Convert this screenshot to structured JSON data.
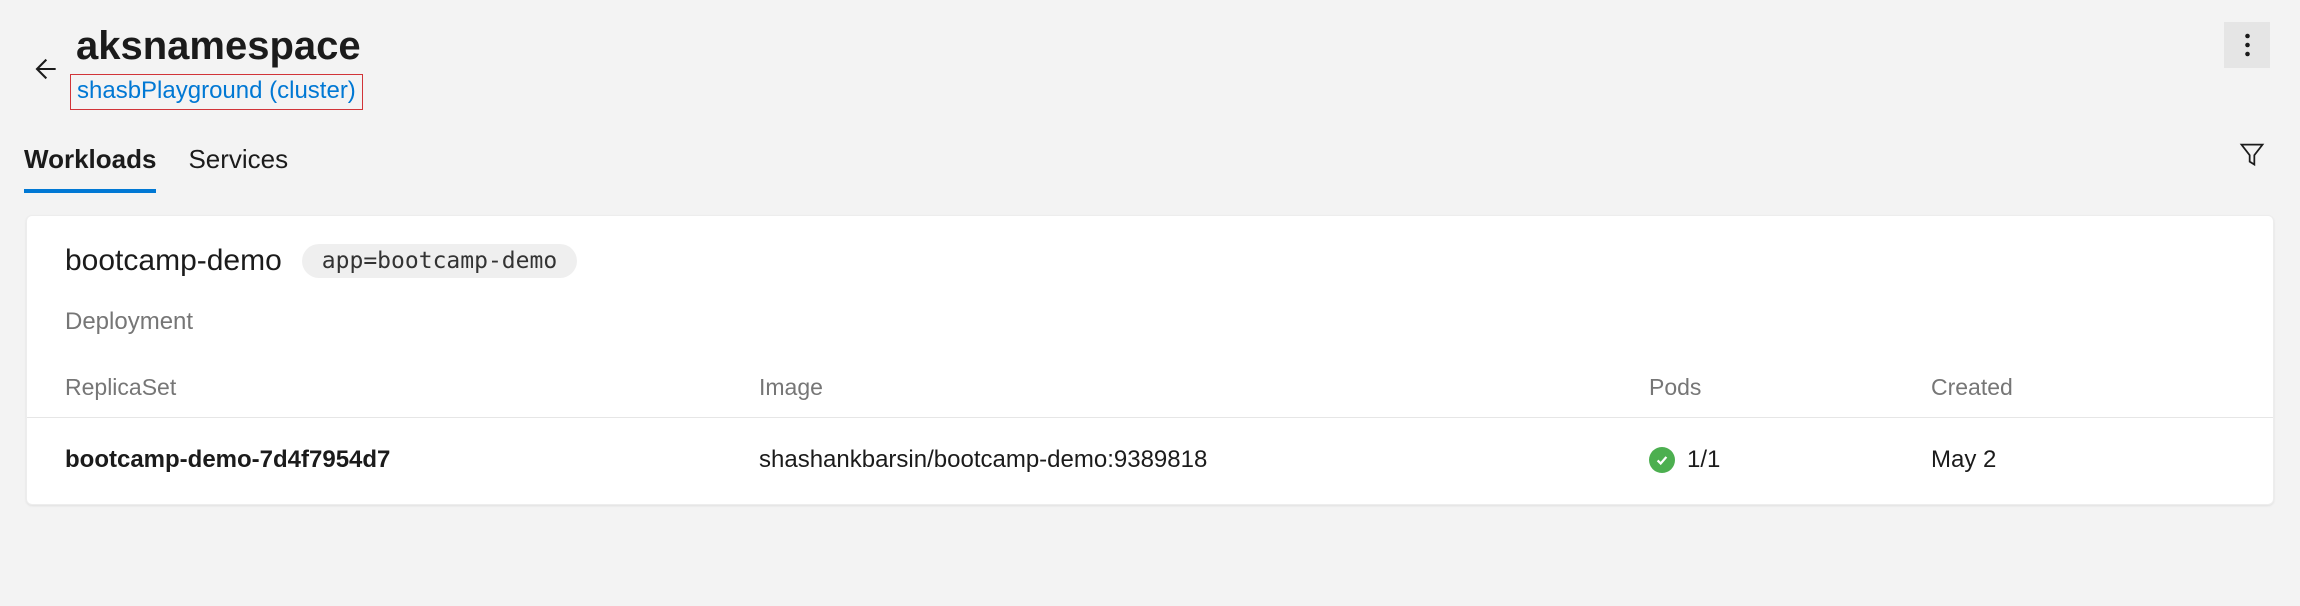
{
  "header": {
    "title": "aksnamespace",
    "cluster_link": "shasbPlayground (cluster)"
  },
  "tabs": [
    {
      "label": "Workloads",
      "active": true
    },
    {
      "label": "Services",
      "active": false
    }
  ],
  "workload": {
    "name": "bootcamp-demo",
    "tag": "app=bootcamp-demo",
    "type": "Deployment",
    "columns": {
      "replicaset": "ReplicaSet",
      "image": "Image",
      "pods": "Pods",
      "created": "Created"
    },
    "rows": [
      {
        "replicaset": "bootcamp-demo-7d4f7954d7",
        "image": "shashankbarsin/bootcamp-demo:9389818",
        "pods": "1/1",
        "created": "May 2",
        "status": "ok"
      }
    ]
  }
}
